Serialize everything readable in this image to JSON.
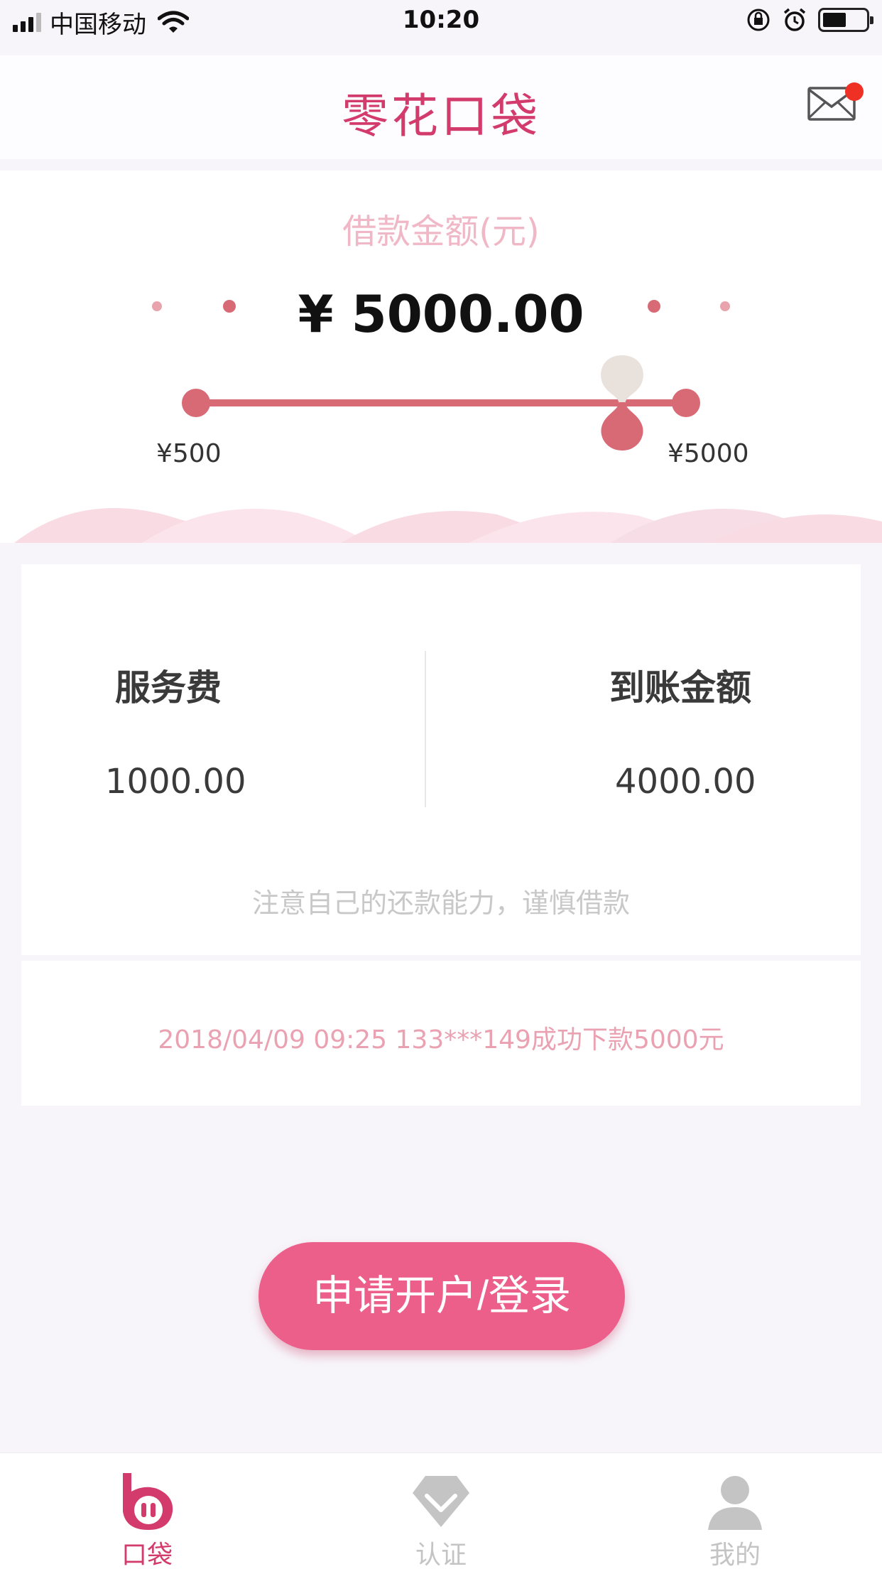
{
  "status_bar": {
    "carrier": "中国移动",
    "time": "10:20"
  },
  "header": {
    "title": "零花口袋",
    "has_unread_badge": true
  },
  "loan": {
    "label": "借款金额(元)",
    "amount": "¥ 5000.00",
    "slider_min_label": "¥500",
    "slider_max_label": "¥5000",
    "slider_value_fraction": 0.9
  },
  "fees": {
    "service_fee_title": "服务费",
    "service_fee_value": "1000.00",
    "received_title": "到账金额",
    "received_value": "4000.00",
    "notice": "注意自己的还款能力，谨慎借款"
  },
  "news": {
    "text": "2018/04/09 09:25 133***149成功下款5000元"
  },
  "apply_button": {
    "label": "申请开户/登录"
  },
  "tab_bar": {
    "tabs": [
      {
        "label": "口袋",
        "icon": "pocket-icon",
        "active": true
      },
      {
        "label": "认证",
        "icon": "diamond-icon",
        "active": false
      },
      {
        "label": "我的",
        "icon": "user-icon",
        "active": false
      }
    ]
  },
  "colors": {
    "brand": "#d23b6b",
    "button": "#ec5f8a",
    "slider": "#d86a76",
    "tab_active": "#d23b6b",
    "tab_inactive": "#c4c4c4"
  }
}
